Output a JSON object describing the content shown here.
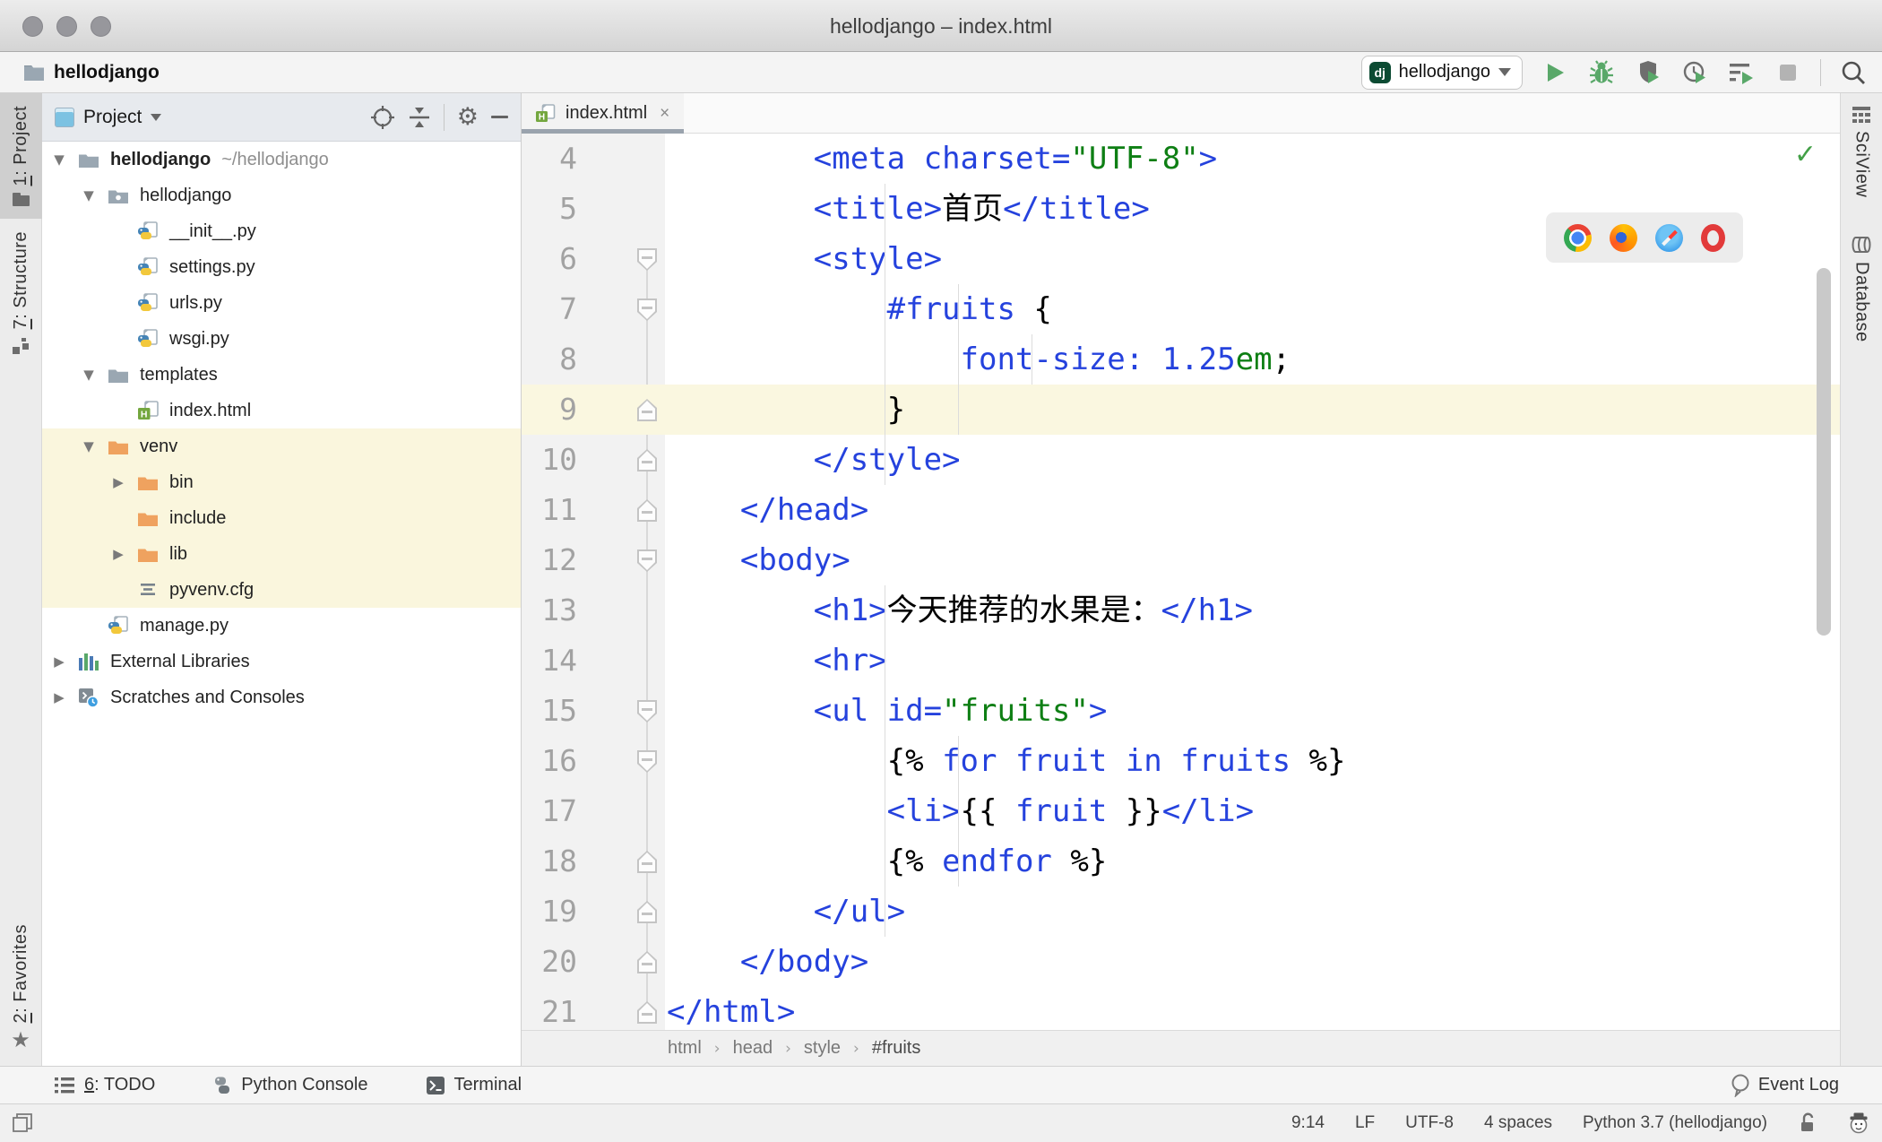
{
  "window": {
    "title": "hellodjango – index.html"
  },
  "navbar": {
    "breadcrumb": "hellodjango",
    "run_config": {
      "badge": "dj",
      "label": "hellodjango"
    },
    "toolbar_icons": [
      "run-icon",
      "debug-icon",
      "coverage-icon",
      "profiler-icon",
      "run-with-config-icon",
      "stop-icon",
      "search-everywhere-icon"
    ]
  },
  "left_strip": {
    "tabs": [
      {
        "mnemonic": "1",
        "rest": ": Project",
        "icon": "folder-icon",
        "active": true
      },
      {
        "mnemonic": "7",
        "rest": ": Structure",
        "icon": "structure-icon",
        "active": false
      }
    ],
    "bottom_tabs": [
      {
        "mnemonic": "2",
        "rest": ": Favorites",
        "icon": "star-icon",
        "active": false
      }
    ]
  },
  "right_strip": {
    "tabs": [
      {
        "label": "SciView",
        "icon": "sciview-icon"
      },
      {
        "label": "Database",
        "icon": "database-icon"
      }
    ]
  },
  "project_panel": {
    "title": "Project",
    "header_icons": [
      "locate-icon",
      "collapse-all-icon",
      "gear-icon",
      "hide-icon"
    ],
    "tree": [
      {
        "label": "hellodjango",
        "hint": "~/hellodjango",
        "icon": "folder-gray",
        "level": 0,
        "chev": "open",
        "bold": true,
        "hl": false
      },
      {
        "label": "hellodjango",
        "icon": "package",
        "level": 1,
        "chev": "open",
        "bold": false,
        "hl": false
      },
      {
        "label": "__init__.py",
        "icon": "py",
        "level": 2,
        "chev": "",
        "bold": false,
        "hl": false
      },
      {
        "label": "settings.py",
        "icon": "py",
        "level": 2,
        "chev": "",
        "bold": false,
        "hl": false
      },
      {
        "label": "urls.py",
        "icon": "py",
        "level": 2,
        "chev": "",
        "bold": false,
        "hl": false
      },
      {
        "label": "wsgi.py",
        "icon": "py",
        "level": 2,
        "chev": "",
        "bold": false,
        "hl": false
      },
      {
        "label": "templates",
        "icon": "folder-gray",
        "level": 1,
        "chev": "open",
        "bold": false,
        "hl": false
      },
      {
        "label": "index.html",
        "icon": "html",
        "level": 2,
        "chev": "",
        "bold": false,
        "hl": false
      },
      {
        "label": "venv",
        "icon": "folder-orange",
        "level": 1,
        "chev": "open",
        "bold": false,
        "hl": true
      },
      {
        "label": "bin",
        "icon": "folder-orange",
        "level": 2,
        "chev": "closed",
        "bold": false,
        "hl": true
      },
      {
        "label": "include",
        "icon": "folder-orange",
        "level": 2,
        "chev": "",
        "bold": false,
        "hl": true
      },
      {
        "label": "lib",
        "icon": "folder-orange",
        "level": 2,
        "chev": "closed",
        "bold": false,
        "hl": true
      },
      {
        "label": "pyvenv.cfg",
        "icon": "cfg",
        "level": 2,
        "chev": "",
        "bold": false,
        "hl": true
      },
      {
        "label": "manage.py",
        "icon": "py",
        "level": 1,
        "chev": "",
        "bold": false,
        "hl": false
      },
      {
        "label": "External Libraries",
        "icon": "extlib",
        "level": 0,
        "chev": "closed",
        "bold": false,
        "hl": false
      },
      {
        "label": "Scratches and Consoles",
        "icon": "scratch",
        "level": 0,
        "chev": "closed",
        "bold": false,
        "hl": false
      }
    ]
  },
  "editor": {
    "tab": {
      "label": "index.html",
      "close": "×"
    },
    "breadcrumbs": [
      "html",
      "head",
      "style",
      "#fruits"
    ],
    "lines": [
      {
        "n": 4,
        "indent": 8,
        "fold": "",
        "cur": false,
        "seg": [
          [
            "<meta",
            "tag"
          ],
          [
            " ",
            "txt"
          ],
          [
            "charset=",
            "attr"
          ],
          [
            "\"UTF-8\"",
            "str"
          ],
          [
            ">",
            "tag"
          ]
        ]
      },
      {
        "n": 5,
        "indent": 8,
        "fold": "",
        "cur": false,
        "seg": [
          [
            "<title>",
            "tag"
          ],
          [
            "首页",
            "txt"
          ],
          [
            "</title>",
            "tag"
          ]
        ]
      },
      {
        "n": 6,
        "indent": 8,
        "fold": "open",
        "cur": false,
        "seg": [
          [
            "<style>",
            "tag"
          ]
        ]
      },
      {
        "n": 7,
        "indent": 12,
        "fold": "open",
        "cur": false,
        "seg": [
          [
            "#fruits",
            "attr"
          ],
          [
            " {",
            "txt"
          ]
        ]
      },
      {
        "n": 8,
        "indent": 16,
        "fold": "",
        "cur": false,
        "seg": [
          [
            "font-size:",
            "attr"
          ],
          [
            " ",
            "txt"
          ],
          [
            "1.25",
            "attr"
          ],
          [
            "em",
            "str"
          ],
          [
            ";",
            "txt"
          ]
        ]
      },
      {
        "n": 9,
        "indent": 12,
        "fold": "close",
        "cur": true,
        "seg": [
          [
            "}",
            "txt"
          ]
        ]
      },
      {
        "n": 10,
        "indent": 8,
        "fold": "close",
        "cur": false,
        "seg": [
          [
            "</style>",
            "tag"
          ]
        ]
      },
      {
        "n": 11,
        "indent": 4,
        "fold": "close",
        "cur": false,
        "seg": [
          [
            "</head>",
            "tag"
          ]
        ]
      },
      {
        "n": 12,
        "indent": 4,
        "fold": "open",
        "cur": false,
        "seg": [
          [
            "<body>",
            "tag"
          ]
        ]
      },
      {
        "n": 13,
        "indent": 8,
        "fold": "",
        "cur": false,
        "seg": [
          [
            "<h1>",
            "tag"
          ],
          [
            "今天推荐的水果是：",
            "txt"
          ],
          [
            "</h1>",
            "tag"
          ]
        ]
      },
      {
        "n": 14,
        "indent": 8,
        "fold": "",
        "cur": false,
        "seg": [
          [
            "<hr>",
            "tag"
          ]
        ]
      },
      {
        "n": 15,
        "indent": 8,
        "fold": "open",
        "cur": false,
        "seg": [
          [
            "<ul",
            "tag"
          ],
          [
            " ",
            "txt"
          ],
          [
            "id=",
            "attr"
          ],
          [
            "\"fruits\"",
            "str"
          ],
          [
            ">",
            "tag"
          ]
        ]
      },
      {
        "n": 16,
        "indent": 12,
        "fold": "open",
        "cur": false,
        "seg": [
          [
            "{% ",
            "txt"
          ],
          [
            "for",
            "kw"
          ],
          [
            " ",
            "txt"
          ],
          [
            "fruit",
            "kw"
          ],
          [
            " ",
            "txt"
          ],
          [
            "in",
            "kw"
          ],
          [
            " ",
            "txt"
          ],
          [
            "fruits",
            "kw"
          ],
          [
            " %}",
            "txt"
          ]
        ]
      },
      {
        "n": 17,
        "indent": 12,
        "fold": "",
        "cur": false,
        "seg": [
          [
            "<li>",
            "tag"
          ],
          [
            "{{ ",
            "txt"
          ],
          [
            "fruit",
            "kw"
          ],
          [
            " }}",
            "txt"
          ],
          [
            "</li>",
            "tag"
          ]
        ]
      },
      {
        "n": 18,
        "indent": 12,
        "fold": "close",
        "cur": false,
        "seg": [
          [
            "{% ",
            "txt"
          ],
          [
            "endfor",
            "kw"
          ],
          [
            " %}",
            "txt"
          ]
        ]
      },
      {
        "n": 19,
        "indent": 8,
        "fold": "close",
        "cur": false,
        "seg": [
          [
            "</ul>",
            "tag"
          ]
        ]
      },
      {
        "n": 20,
        "indent": 4,
        "fold": "close",
        "cur": false,
        "seg": [
          [
            "</body>",
            "tag"
          ]
        ]
      },
      {
        "n": 21,
        "indent": 0,
        "fold": "close",
        "cur": false,
        "seg": [
          [
            "</html>",
            "tag"
          ]
        ]
      }
    ],
    "browser_icons": [
      "chrome-icon",
      "firefox-icon",
      "safari-icon",
      "opera-icon"
    ],
    "inspection_ok": "✓"
  },
  "toolwin_bar": {
    "items": [
      {
        "mnemonic": "6",
        "rest": ": TODO",
        "icon": "todo-icon"
      },
      {
        "mnemonic": "",
        "rest": "Python Console",
        "icon": "python-console-icon"
      },
      {
        "mnemonic": "",
        "rest": "Terminal",
        "icon": "terminal-icon"
      }
    ],
    "event_log": {
      "label": "Event Log",
      "icon": "event-log-icon"
    }
  },
  "statusbar": {
    "items": [
      "9:14",
      "LF",
      "UTF-8",
      "4 spaces",
      "Python 3.7 (hellodjango)"
    ],
    "icons": [
      "unlocked-icon",
      "hector-inspector-icon"
    ],
    "toggle_icon": "toggle-toolwindows-icon"
  },
  "colors": {
    "accent_green": "#59a869",
    "django_badge": "#0c4b33",
    "tag_blue": "#2542dd",
    "string_green": "#0e7f14",
    "excluded_highlight": "#faf6dd",
    "current_line": "#faf7e0",
    "folder_orange": "#efa25f",
    "folder_gray": "#9aa7b2"
  }
}
